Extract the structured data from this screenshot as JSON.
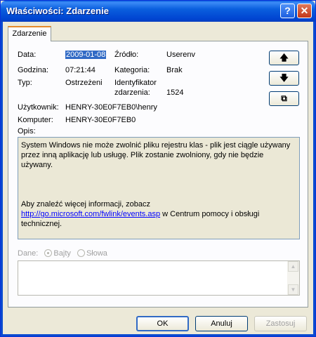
{
  "window": {
    "title": "Właściwości: Zdarzenie",
    "help": "?",
    "close": "✕"
  },
  "tab": {
    "label": "Zdarzenie"
  },
  "fields": {
    "data_label": "Data:",
    "data_value": "2009-01-08",
    "godzina_label": "Godzina:",
    "godzina_value": "07:21:44",
    "typ_label": "Typ:",
    "typ_value": "Ostrzeżeni",
    "zrodlo_label": "Źródło:",
    "zrodlo_value": "Userenv",
    "kategoria_label": "Kategoria:",
    "kategoria_value": "Brak",
    "ident_label_1": "Identyfikator",
    "ident_label_2": "zdarzenia:",
    "ident_value": "1524",
    "uzytkownik_label": "Użytkownik:",
    "uzytkownik_value": "HENRY-30E0F7EB0\\henry",
    "komputer_label": "Komputer:",
    "komputer_value": "HENRY-30E0F7EB0",
    "opis_label": "Opis:"
  },
  "nav": {
    "up": "🡅",
    "down": "🡇",
    "copy": "⧉"
  },
  "description": {
    "line1": "System Windows nie może zwolnić pliku rejestru klas - plik jest ciągle używany przez inną aplikację lub usługę. Plik zostanie zwolniony, gdy nie będzie używany.",
    "line2": "Aby znaleźć więcej informacji, zobacz",
    "link": "http://go.microsoft.com/fwlink/events.asp",
    "line3": " w Centrum pomocy i obsługi technicznej."
  },
  "data_section": {
    "label": "Dane:",
    "opt_bytes": "Bajty",
    "opt_words": "Słowa"
  },
  "buttons": {
    "ok": "OK",
    "cancel": "Anuluj",
    "apply": "Zastosuj"
  }
}
